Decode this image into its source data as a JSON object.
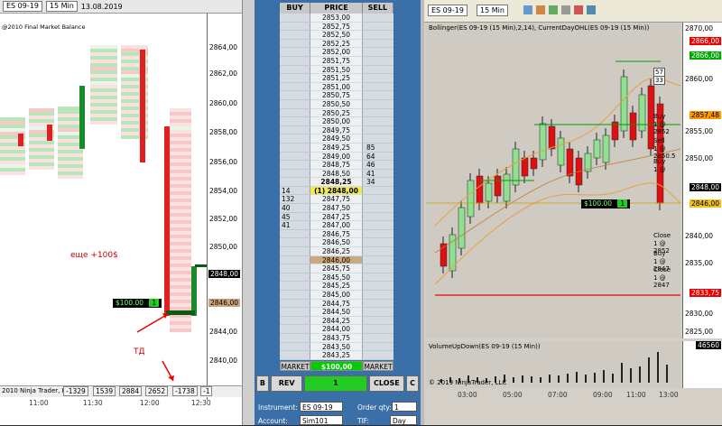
{
  "left": {
    "instrument": "ES 09-19",
    "interval": "15 Min",
    "date": "13.08.2019",
    "copyright": "@2010 Final Market Balance",
    "y_ticks": [
      "2864,00",
      "2862,00",
      "2860,00",
      "2858,00",
      "2856,00",
      "2854,00",
      "2852,00",
      "2850,00",
      "2848,00",
      "2846,00",
      "2844,00",
      "2842,00",
      "2840,00"
    ],
    "last_price": "2848,00",
    "entry_price": "2846,00",
    "x_ticks": [
      "11:00",
      "11:30",
      "12:00",
      "12:30"
    ],
    "deltas": [
      "-1329",
      "1539",
      "2884",
      "2652",
      "-1738",
      "-1"
    ],
    "footer": "2010 Ninja Trader, LLC",
    "annotation_profit": "еще +100$",
    "annotation_td": "ТД",
    "pnl_badge": "$100.00",
    "pnl_qty": "1"
  },
  "dom": {
    "col_buy": "BUY",
    "col_price": "PRICE",
    "col_sell": "SELL",
    "rows": [
      {
        "buy": "",
        "price": "2853,00",
        "sell": ""
      },
      {
        "buy": "",
        "price": "2852,75",
        "sell": ""
      },
      {
        "buy": "",
        "price": "2852,50",
        "sell": ""
      },
      {
        "buy": "",
        "price": "2852,25",
        "sell": ""
      },
      {
        "buy": "",
        "price": "2852,00",
        "sell": ""
      },
      {
        "buy": "",
        "price": "2851,75",
        "sell": ""
      },
      {
        "buy": "",
        "price": "2851,50",
        "sell": ""
      },
      {
        "buy": "",
        "price": "2851,25",
        "sell": ""
      },
      {
        "buy": "",
        "price": "2851,00",
        "sell": ""
      },
      {
        "buy": "",
        "price": "2850,75",
        "sell": ""
      },
      {
        "buy": "",
        "price": "2850,50",
        "sell": ""
      },
      {
        "buy": "",
        "price": "2850,25",
        "sell": ""
      },
      {
        "buy": "",
        "price": "2850,00",
        "sell": ""
      },
      {
        "buy": "",
        "price": "2849,75",
        "sell": ""
      },
      {
        "buy": "",
        "price": "2849,50",
        "sell": ""
      },
      {
        "buy": "",
        "price": "2849,25",
        "sell": "85"
      },
      {
        "buy": "",
        "price": "2849,00",
        "sell": "64"
      },
      {
        "buy": "",
        "price": "2848,75",
        "sell": "46"
      },
      {
        "buy": "",
        "price": "2848,50",
        "sell": "41"
      },
      {
        "buy": "",
        "price": "2848,25",
        "sell": "34"
      },
      {
        "buy": "14",
        "price": "(1) 2848,00",
        "sell": ""
      },
      {
        "buy": "132",
        "price": "2847,75",
        "sell": ""
      },
      {
        "buy": "40",
        "price": "2847,50",
        "sell": ""
      },
      {
        "buy": "45",
        "price": "2847,25",
        "sell": ""
      },
      {
        "buy": "41",
        "price": "2847,00",
        "sell": ""
      },
      {
        "buy": "",
        "price": "2846,75",
        "sell": ""
      },
      {
        "buy": "",
        "price": "2846,50",
        "sell": ""
      },
      {
        "buy": "",
        "price": "2846,25",
        "sell": ""
      },
      {
        "buy": "",
        "price": "2846,00",
        "sell": ""
      },
      {
        "buy": "",
        "price": "2845,75",
        "sell": ""
      },
      {
        "buy": "",
        "price": "2845,50",
        "sell": ""
      },
      {
        "buy": "",
        "price": "2845,25",
        "sell": ""
      },
      {
        "buy": "",
        "price": "2845,00",
        "sell": ""
      },
      {
        "buy": "",
        "price": "2844,75",
        "sell": ""
      },
      {
        "buy": "",
        "price": "2844,50",
        "sell": ""
      },
      {
        "buy": "",
        "price": "2844,25",
        "sell": ""
      },
      {
        "buy": "",
        "price": "2844,00",
        "sell": ""
      },
      {
        "buy": "",
        "price": "2843,75",
        "sell": ""
      },
      {
        "buy": "",
        "price": "2843,50",
        "sell": ""
      },
      {
        "buy": "",
        "price": "2843,25",
        "sell": ""
      }
    ],
    "market_left": "MARKET",
    "pnl": "$100,00",
    "market_right": "MARKET",
    "btn_b": "B",
    "btn_rev": "REV",
    "qty_value": "1",
    "btn_close": "CLOSE",
    "btn_c": "C",
    "lbl_instrument": "Instrument:",
    "instrument": "ES 09-19",
    "lbl_order_qty": "Order qty:",
    "order_qty": "1",
    "lbl_account": "Account:",
    "account": "Sim101",
    "lbl_tif": "TIF:",
    "tif": "Day"
  },
  "right": {
    "instrument": "ES 09-19",
    "interval": "15 Min",
    "indicator_label": "Bollinger(ES 09-19 (15 Min),2,14), CurrentDayOHL(ES 09-19 (15 Min))",
    "y_ticks": [
      "2870,00",
      "2865,00",
      "2860,00",
      "2855,00",
      "2850,00",
      "2845,00",
      "2840,00",
      "2835,00",
      "2830,00",
      "2825,00"
    ],
    "tag_high": "2866,00",
    "tag_mid": "2857,48",
    "tag_last": "2848,00",
    "tag_entry": "2846,00",
    "tag_stop": "2833,75",
    "pnl_badge": "$100.00",
    "pnl_qty": "1",
    "order_labels": [
      "Buy",
      "1 @ 2852",
      "Sell",
      "1 @ 2850.5",
      "Buy",
      "1 @",
      "Close",
      "1 @ 2852",
      "Buy",
      "1 @ 2847",
      "Close",
      "1 @ 2847"
    ],
    "small_tags": [
      "57",
      "33"
    ],
    "vol_label": "VolumeUpDown(ES 09-19 (15 Min))",
    "vol_value": "46560",
    "footer": "© 2019 NinjaTrader, LLC",
    "x_ticks": [
      "03:00",
      "05:00",
      "07:00",
      "09:00",
      "11:00",
      "13:00"
    ]
  }
}
